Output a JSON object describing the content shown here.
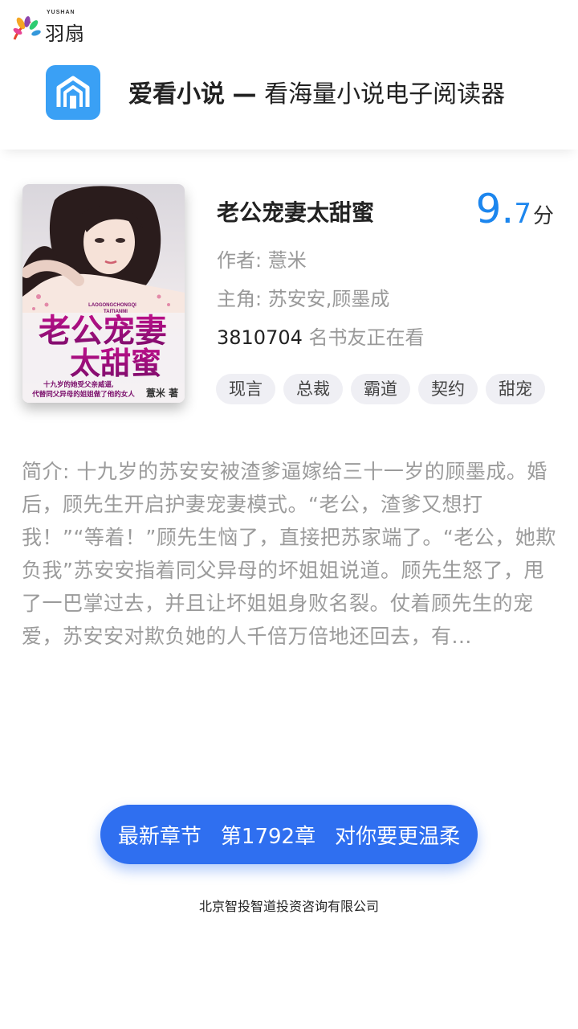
{
  "brand": {
    "name": "羽扇",
    "sub": "YUSHAN"
  },
  "app": {
    "name": "爱看小说",
    "dash": "—",
    "slogan": "看海量小说电子阅读器"
  },
  "book": {
    "title": "老公宠妻太甜蜜",
    "score_int": "9.",
    "score_dec": "7",
    "score_unit": "分",
    "author": "作者: 薏米",
    "protagonists": "主角: 苏安安,顾墨成",
    "reader_count": "3810704",
    "reader_suffix": " 名书友正在看",
    "tags": [
      "现言",
      "总裁",
      "霸道",
      "契约",
      "甜宠"
    ],
    "cover": {
      "title_line1": "老公宠妻",
      "title_line2": "太甜蜜",
      "pinyin_line1": "LAOGONGCHONGQI",
      "pinyin_line2": "TAITIANMI",
      "tagline_line1": "十九岁的她受父亲威逼,",
      "tagline_line2": "代替同父异母的姐姐做了他的女人",
      "author_mark": "薏米 著"
    }
  },
  "intro": "简介: 十九岁的苏安安被渣爹逼嫁给三十一岁的顾墨成。婚后，顾先生开启护妻宠妻模式。“老公，渣爹又想打我！”“等着！”顾先生恼了，直接把苏家端了。“老公，她欺负我”苏安安指着同父异母的坏姐姐说道。顾先生怒了，甩了一巴掌过去，并且让坏姐姐身败名裂。仗着顾先生的宠爱，苏安安对欺负她的人千倍万倍地还回去，有...",
  "cta": {
    "prefix": "最新章节",
    "chapter": "第1792章",
    "chapter_title": "对你要更温柔"
  },
  "company": "北京智投智道投资咨询有限公司",
  "colors": {
    "accent": "#1c86ee",
    "cta": "#2f6ff0",
    "app_icon": "#3aa0f5"
  }
}
